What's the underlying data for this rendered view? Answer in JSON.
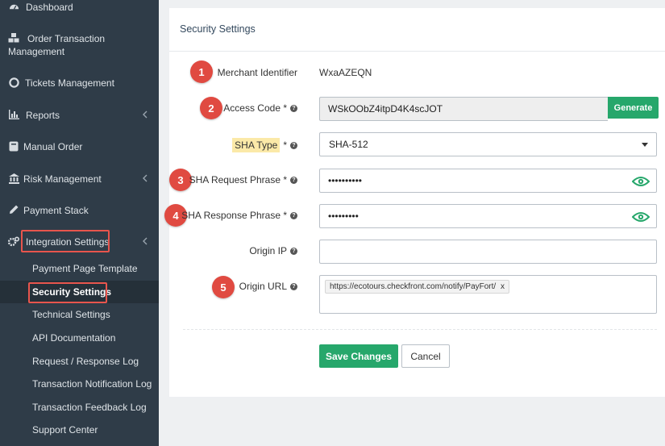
{
  "sidebar": {
    "items": [
      {
        "label": "Dashboard"
      },
      {
        "label": "Order Transaction",
        "label2": "Management"
      },
      {
        "label": "Tickets Management"
      },
      {
        "label": "Reports"
      },
      {
        "label": "Manual Order"
      },
      {
        "label": "Risk Management"
      },
      {
        "label": "Payment Stack"
      },
      {
        "label": "Integration Settings"
      }
    ],
    "submenu": [
      {
        "label": "Payment Page Template"
      },
      {
        "label": "Security Settings"
      },
      {
        "label": "Technical Settings"
      },
      {
        "label": "API Documentation"
      },
      {
        "label": "Request / Response Log"
      },
      {
        "label": "Transaction Notification Log"
      },
      {
        "label": "Transaction Feedback Log"
      },
      {
        "label": "Support Center"
      }
    ]
  },
  "panel": {
    "title": "Security Settings",
    "badges": [
      "1",
      "2",
      "3",
      "4",
      "5"
    ],
    "fields": {
      "merchant_identifier": {
        "label": "Merchant Identifier",
        "value": "WxaAZEQN"
      },
      "access_code": {
        "label": "Access Code *",
        "value": "WSkOObZ4itpD4K4scJOT",
        "button": "Generate"
      },
      "sha_type": {
        "label": "SHA Type",
        "required": "*",
        "value": "SHA-512"
      },
      "sha_request": {
        "label": "SHA Request Phrase *",
        "value": "••••••••••"
      },
      "sha_response": {
        "label": "SHA Response Phrase *",
        "value": "•••••••••"
      },
      "origin_ip": {
        "label": "Origin IP",
        "value": ""
      },
      "origin_url": {
        "label": "Origin URL",
        "tag": "https://ecotours.checkfront.com/notify/PayFort/",
        "tag_remove": "x"
      }
    },
    "actions": {
      "save": "Save Changes",
      "cancel": "Cancel"
    }
  },
  "colors": {
    "sidebar_bg": "#2f3c48",
    "accent_green": "#26a76b",
    "badge_red": "#e04a41",
    "highlight_border": "#e8554d",
    "sha_highlight": "#fbe9a8"
  }
}
